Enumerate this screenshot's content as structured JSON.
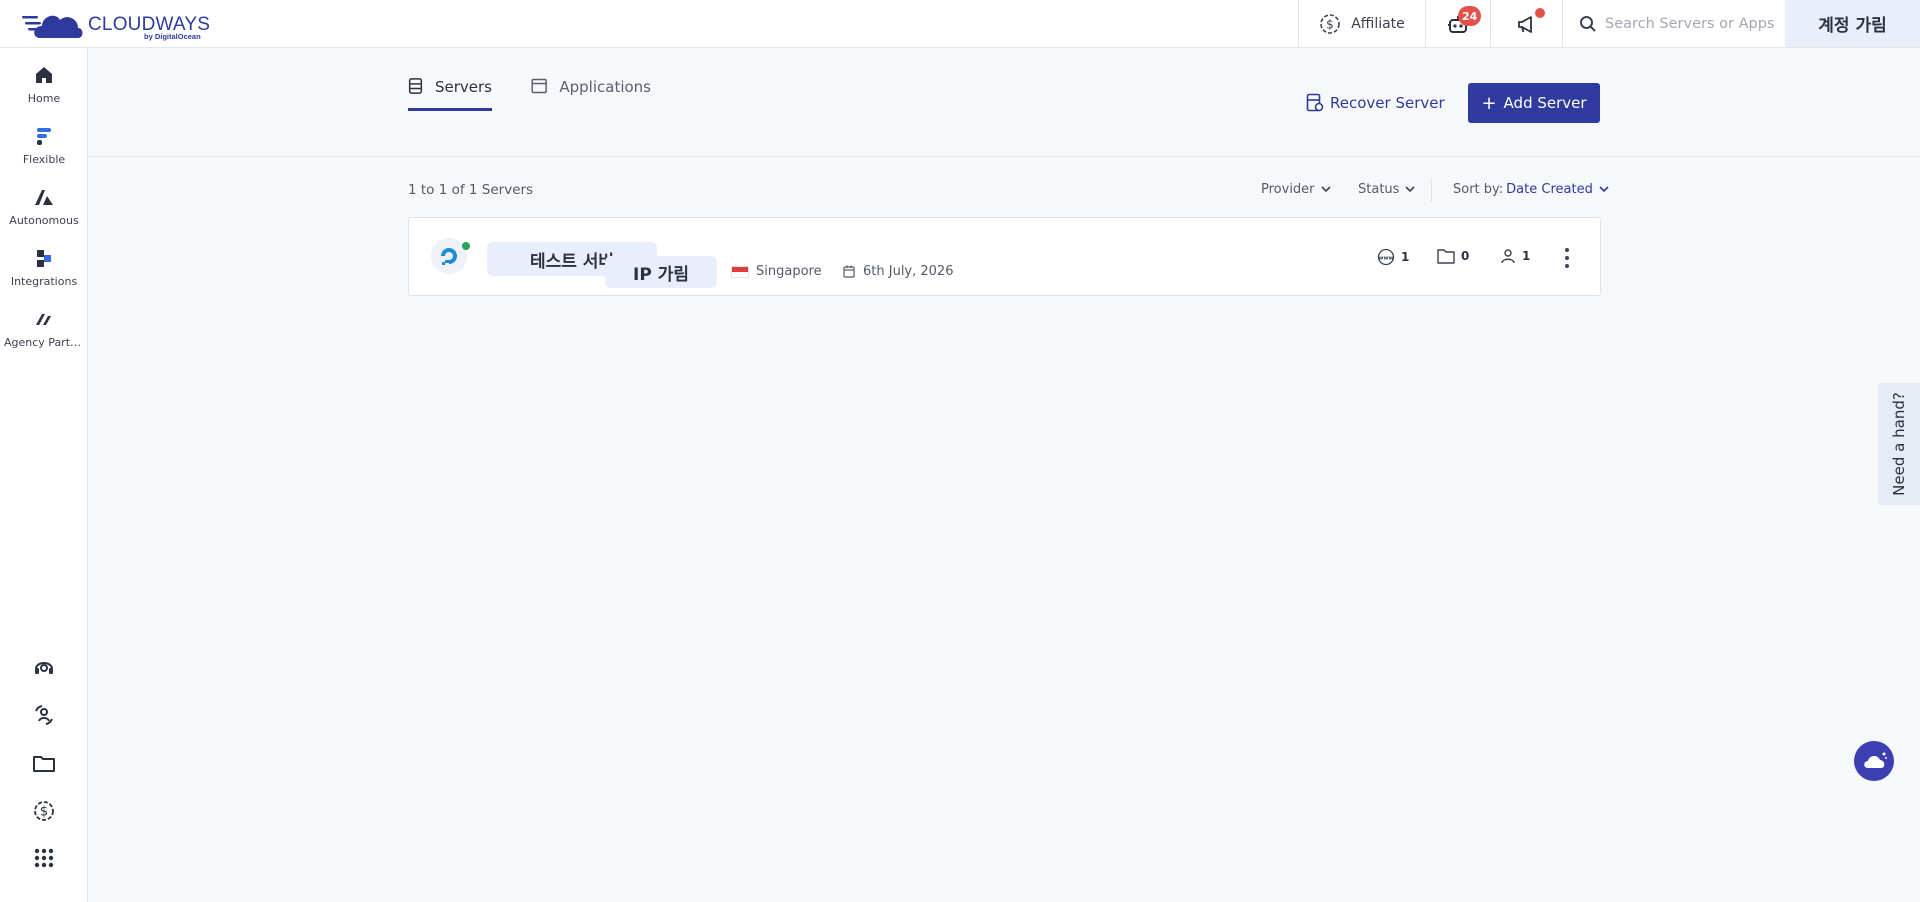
{
  "brand": {
    "name": "CLOUDWAYS",
    "sub": "by DigitalOcean"
  },
  "topbar": {
    "affiliate_label": "Affiliate",
    "bot_badge": "24",
    "search_placeholder": "Search Servers or Apps",
    "account_label": "계정 가림"
  },
  "sidebar": {
    "items": [
      {
        "label": "Home",
        "icon": "home-icon"
      },
      {
        "label": "Flexible",
        "icon": "flexible-icon"
      },
      {
        "label": "Autonomous",
        "icon": "autonomous-icon"
      },
      {
        "label": "Integrations",
        "icon": "integrations-icon"
      },
      {
        "label": "Agency Partner",
        "icon": "agency-partner-icon"
      }
    ],
    "bottom_icons": [
      "support-icon",
      "team-icon",
      "folder-icon",
      "billing-icon",
      "apps-grid-icon"
    ]
  },
  "tabs": [
    {
      "label": "Servers",
      "active": true
    },
    {
      "label": "Applications",
      "active": false
    }
  ],
  "actions": {
    "recover_label": "Recover Server",
    "add_label": "Add Server"
  },
  "list": {
    "count_text": "1 to 1 of 1 Servers",
    "filters": {
      "provider": "Provider",
      "status": "Status",
      "sort_prefix": "Sort by:",
      "sort_value": "Date Created"
    }
  },
  "servers": [
    {
      "name_masked": "테스트 서버",
      "ip_masked": "IP 가림",
      "location": "Singapore",
      "created": "6th July, 2026",
      "websites": "1",
      "apps": "0",
      "users": "1",
      "status_color": "#2ea25d"
    }
  ],
  "help_label": "Need a hand?",
  "colors": {
    "brand": "#2f3a9e",
    "badge": "#e2514a",
    "status_online": "#2ea25d"
  }
}
